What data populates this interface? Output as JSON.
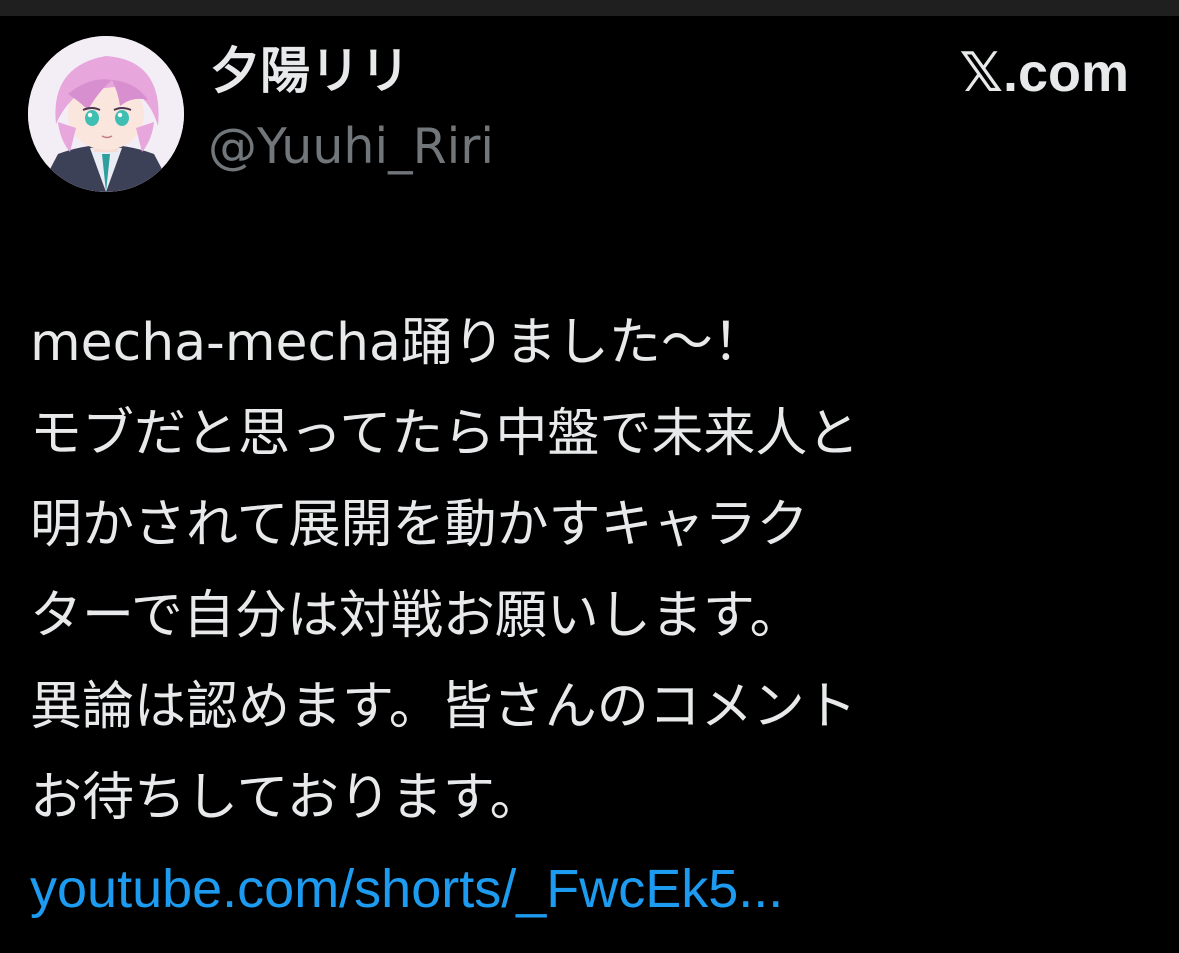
{
  "post": {
    "author": {
      "display_name": "夕陽リリ",
      "handle": "@Yuuhi_Riri"
    },
    "site": {
      "logo_glyph": "𝕏",
      "domain_suffix": ".com"
    },
    "text_lines": [
      "mecha-mecha踊りました～！",
      "モブだと思ってたら中盤で未来人と",
      "明かされて展開を動かすキャラク",
      "ターで自分は対戦お願いします。",
      "異論は認めます。皆さんのコメント",
      "お待ちしております。"
    ],
    "link_text": "youtube.com/shorts/_FwcEk5..."
  },
  "colors": {
    "background": "#000000",
    "primary_text": "#e7e9ea",
    "secondary_text": "#71767b",
    "link": "#1d9bf0"
  },
  "icons": {
    "avatar": "anime-avatar-pink-hair",
    "brand": "x-logo-icon"
  }
}
